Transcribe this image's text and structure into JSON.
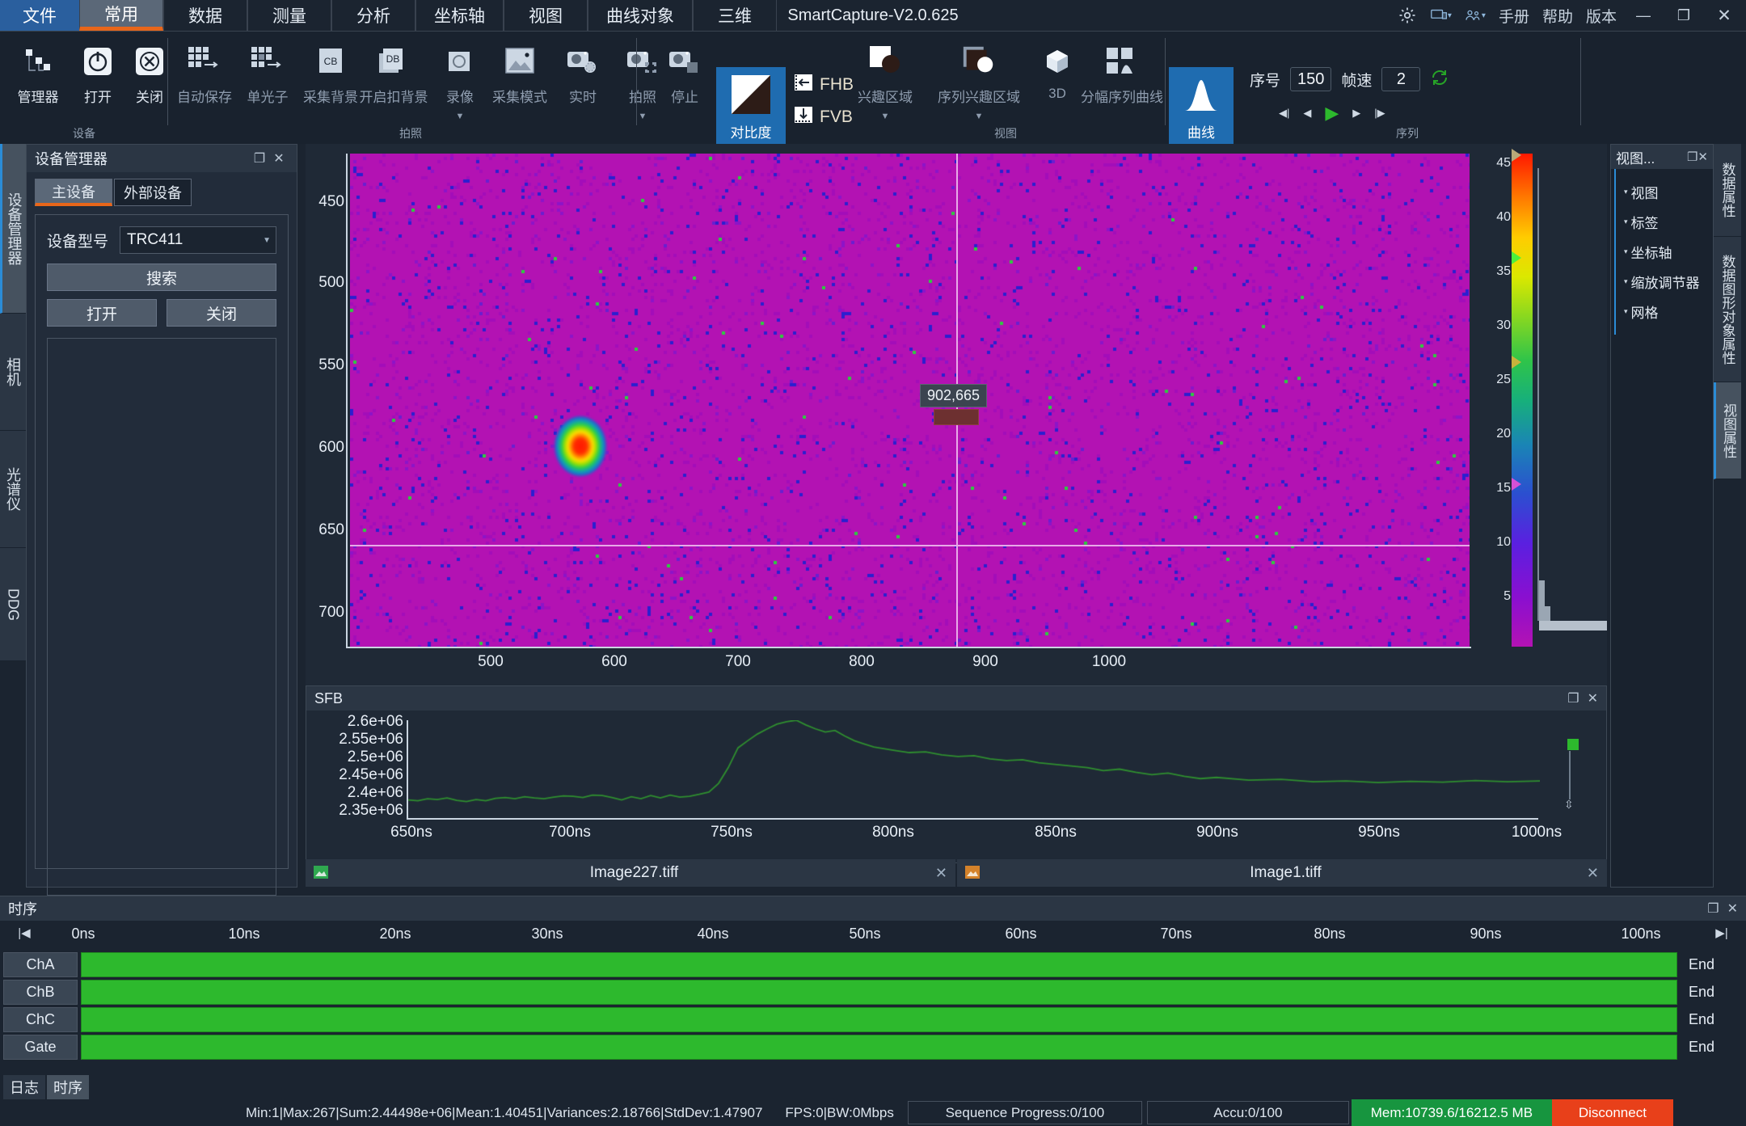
{
  "window": {
    "title": "SmartCapture-V2.0.625",
    "right_items": [
      "手册",
      "帮助",
      "版本"
    ],
    "min": "—",
    "max": "❐",
    "close": "✕"
  },
  "menu": {
    "file": "文件",
    "tabs": [
      {
        "label": "常用",
        "active": true
      },
      {
        "label": "数据",
        "active": false
      },
      {
        "label": "测量",
        "active": false
      },
      {
        "label": "分析",
        "active": false
      },
      {
        "label": "坐标轴",
        "active": false
      },
      {
        "label": "视图",
        "active": false
      },
      {
        "label": "曲线对象",
        "active": false
      },
      {
        "label": "三维",
        "active": false
      }
    ]
  },
  "ribbon": {
    "groups": [
      {
        "caption": "设备"
      },
      {
        "caption": "拍照"
      },
      {
        "caption": "视图"
      },
      {
        "caption": "序列"
      }
    ],
    "device_items": [
      {
        "label": "管理器",
        "icon": "manager-icon"
      },
      {
        "label": "打开",
        "icon": "power-icon"
      },
      {
        "label": "关闭",
        "icon": "close-circle-icon"
      }
    ],
    "capture_items": [
      {
        "label": "自动保存",
        "icon": "autosave-icon"
      },
      {
        "label": "单光子",
        "icon": "single-photon-icon"
      },
      {
        "label": "采集背景",
        "icon": "cb-icon"
      },
      {
        "label": "开启扣背景",
        "icon": "db-icon"
      },
      {
        "label": "录像",
        "icon": "record-icon"
      },
      {
        "label": "采集模式",
        "icon": "image-icon"
      },
      {
        "label": "实时",
        "icon": "camera-live-icon"
      },
      {
        "label": "拍照",
        "icon": "camera-snap-icon"
      },
      {
        "label": "停止",
        "icon": "camera-stop-icon"
      }
    ],
    "contrast": {
      "label": "对比度",
      "icon": "contrast-icon",
      "selected": true
    },
    "fhb": "FHB",
    "fvb": "FVB",
    "view_items": [
      {
        "label": "兴趣区域",
        "icon": "roi-icon"
      },
      {
        "label": "序列兴趣区域",
        "icon": "seq-roi-icon"
      },
      {
        "label": "3D",
        "icon": "cube-icon"
      },
      {
        "label": "分幅序列曲线",
        "icon": "split-seq-curve-icon"
      }
    ],
    "curve": {
      "label": "曲线",
      "icon": "curve-icon",
      "selected": true
    },
    "sequence": {
      "index_label": "序号",
      "index_value": "150",
      "fps_label": "帧速",
      "fps_value": "2",
      "loop_icon": "loop-icon"
    }
  },
  "left_tabs": [
    {
      "label": "设备管理器",
      "active": true
    },
    {
      "label": "相机",
      "active": false
    },
    {
      "label": "光谱仪",
      "active": false
    },
    {
      "label": "DDG",
      "active": false
    }
  ],
  "device_panel": {
    "title": "设备管理器",
    "tabs": [
      {
        "label": "主设备",
        "active": true
      },
      {
        "label": "外部设备",
        "active": false
      }
    ],
    "model_label": "设备型号",
    "model_value": "TRC411",
    "search_button": "搜索",
    "open_button": "打开",
    "close_button": "关闭"
  },
  "image_view": {
    "y_ticks": [
      "450",
      "500",
      "550",
      "600",
      "650",
      "700"
    ],
    "x_ticks": [
      "500",
      "600",
      "700",
      "800",
      "900",
      "1000"
    ],
    "readout": "902,665",
    "colorbar_ticks": [
      "45",
      "40",
      "35",
      "30",
      "25",
      "20",
      "15",
      "10",
      "5"
    ],
    "colorbar_min": 2,
    "colorbar_max": 46
  },
  "sfb": {
    "title": "SFB"
  },
  "chart_data": {
    "type": "line",
    "title": "SFB",
    "xlabel": "",
    "ylabel": "",
    "x_ticks": [
      "650ns",
      "700ns",
      "750ns",
      "800ns",
      "850ns",
      "900ns",
      "950ns",
      "1000ns"
    ],
    "y_ticks": [
      "2.6e+06",
      "2.55e+06",
      "2.5e+06",
      "2.45e+06",
      "2.4e+06",
      "2.35e+06"
    ],
    "xlim": [
      650,
      1000
    ],
    "ylim": [
      2350000,
      2600000
    ],
    "series": [
      {
        "name": "SFB",
        "color": "#2f8f2f",
        "x": [
          650,
          653,
          656,
          659,
          662,
          665,
          668,
          671,
          674,
          677,
          680,
          683,
          686,
          689,
          692,
          695,
          698,
          701,
          704,
          707,
          710,
          713,
          716,
          719,
          722,
          725,
          728,
          731,
          734,
          737,
          740,
          743,
          746,
          749,
          752,
          755,
          758,
          761,
          764,
          767,
          770,
          773,
          776,
          779,
          782,
          785,
          788,
          791,
          794,
          797,
          800,
          805,
          810,
          815,
          820,
          825,
          830,
          835,
          840,
          845,
          850,
          855,
          860,
          865,
          870,
          875,
          880,
          885,
          890,
          895,
          900,
          910,
          920,
          930,
          940,
          950,
          960,
          970,
          980,
          990,
          1000
        ],
        "y": [
          2398000,
          2396000,
          2401000,
          2399000,
          2403000,
          2397000,
          2394000,
          2399000,
          2396000,
          2402000,
          2404000,
          2401000,
          2406000,
          2403000,
          2401000,
          2405000,
          2408000,
          2407000,
          2404000,
          2410000,
          2409000,
          2404000,
          2398000,
          2406000,
          2401000,
          2409000,
          2403000,
          2410000,
          2405000,
          2407000,
          2412000,
          2418000,
          2440000,
          2480000,
          2530000,
          2548000,
          2565000,
          2578000,
          2590000,
          2596000,
          2600000,
          2588000,
          2578000,
          2570000,
          2574000,
          2560000,
          2548000,
          2540000,
          2532000,
          2528000,
          2524000,
          2518000,
          2520000,
          2512000,
          2508000,
          2510000,
          2502000,
          2498000,
          2500000,
          2492000,
          2488000,
          2484000,
          2480000,
          2472000,
          2476000,
          2468000,
          2462000,
          2466000,
          2458000,
          2452000,
          2455000,
          2448000,
          2450000,
          2444000,
          2446000,
          2442000,
          2445000,
          2443000,
          2447000,
          2444000,
          2446000
        ]
      }
    ],
    "grid": false,
    "legend": "none"
  },
  "file_tabs": [
    {
      "name": "Image227.tiff",
      "icon": "image-file-icon"
    },
    {
      "name": "Image1.tiff",
      "icon": "image-file-icon"
    }
  ],
  "right_panel": {
    "title": "视图...",
    "tree": [
      "视图",
      "标签",
      "坐标轴",
      "缩放调节器",
      "网格"
    ],
    "tabs": [
      {
        "label": "数据属性",
        "active": false
      },
      {
        "label": "数据图形对象属性",
        "active": false
      },
      {
        "label": "视图属性",
        "active": true
      }
    ]
  },
  "timing": {
    "title": "时序",
    "ruler": [
      "0ns",
      "10ns",
      "20ns",
      "30ns",
      "40ns",
      "50ns",
      "60ns",
      "70ns",
      "80ns",
      "90ns",
      "100ns"
    ],
    "channels": [
      {
        "name": "ChA",
        "end": "End"
      },
      {
        "name": "ChB",
        "end": "End"
      },
      {
        "name": "ChC",
        "end": "End"
      },
      {
        "name": "Gate",
        "end": "End"
      }
    ]
  },
  "bottom_tabs": [
    {
      "label": "日志",
      "active": false
    },
    {
      "label": "时序",
      "active": true
    }
  ],
  "statusbar": {
    "stats": "Min:1|Max:267|Sum:2.44498e+06|Mean:1.40451|Variances:2.18766|StdDev:1.47907",
    "fps": "FPS:0|BW:0Mbps",
    "sequence_progress": "Sequence Progress:0/100",
    "accu": "Accu:0/100",
    "memory": "Mem:10739.6/16212.5 MB",
    "connection": "Disconnect"
  },
  "colors": {
    "accent_blue": "#1f6cb0",
    "tab_orange": "#e8661a",
    "status_green": "#17953f",
    "status_red": "#e8401a",
    "curve_green": "#2f8f2f"
  }
}
